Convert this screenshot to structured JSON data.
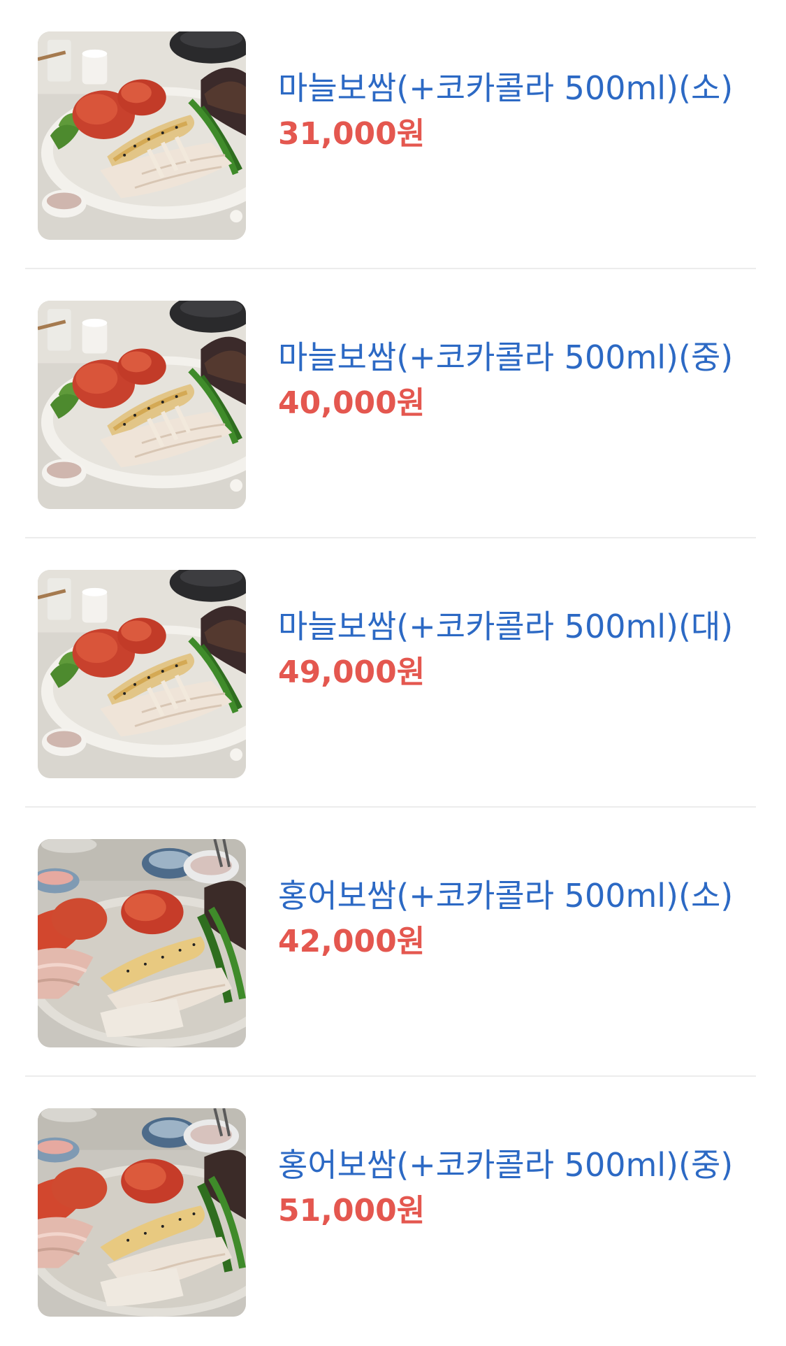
{
  "menu": {
    "items": [
      {
        "name": "마늘보쌈(+코카콜라 500ml)(소)",
        "price": "31,000원",
        "image_icon": "garlic-bossam-photo"
      },
      {
        "name": "마늘보쌈(+코카콜라 500ml)(중)",
        "price": "40,000원",
        "image_icon": "garlic-bossam-photo"
      },
      {
        "name": "마늘보쌈(+코카콜라 500ml)(대)",
        "price": "49,000원",
        "image_icon": "garlic-bossam-photo"
      },
      {
        "name": "홍어보쌈(+코카콜라 500ml)(소)",
        "price": "42,000원",
        "image_icon": "skate-bossam-photo"
      },
      {
        "name": "홍어보쌈(+코카콜라 500ml)(중)",
        "price": "51,000원",
        "image_icon": "skate-bossam-photo"
      }
    ]
  },
  "colors": {
    "name": "#2c69c4",
    "price": "#e4574f",
    "divider": "#ececec"
  }
}
